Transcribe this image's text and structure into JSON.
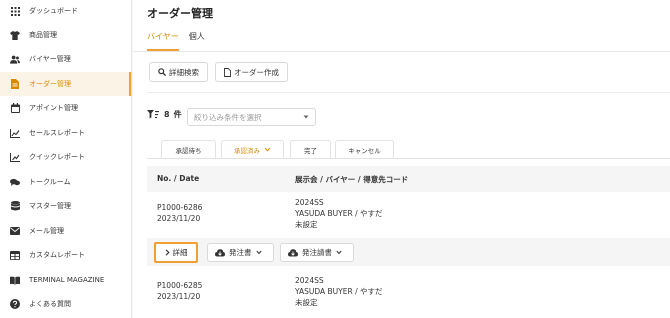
{
  "sidebar": {
    "items": [
      {
        "label": "ダッシュボード",
        "icon": "grid-icon"
      },
      {
        "label": "商品管理",
        "icon": "shirt-icon"
      },
      {
        "label": "バイヤー管理",
        "icon": "users-icon"
      },
      {
        "label": "オーダー管理",
        "icon": "document-icon",
        "active": true
      },
      {
        "label": "アポイント管理",
        "icon": "calendar-icon"
      },
      {
        "label": "セールスレポート",
        "icon": "trend-chart-icon"
      },
      {
        "label": "クイックレポート",
        "icon": "bar-chart-icon"
      },
      {
        "label": "トークルーム",
        "icon": "chat-icon"
      },
      {
        "label": "マスター管理",
        "icon": "database-icon"
      },
      {
        "label": "メール管理",
        "icon": "mail-icon"
      },
      {
        "label": "カスタムレポート",
        "icon": "table-icon"
      },
      {
        "label": "TERMINAL MAGAZINE",
        "icon": "book-icon"
      },
      {
        "label": "よくある質問",
        "icon": "question-icon"
      }
    ]
  },
  "main": {
    "title": "オーダー管理",
    "tabs": [
      {
        "label": "バイヤー",
        "active": true
      },
      {
        "label": "個人",
        "active": false
      }
    ],
    "buttons": {
      "detail_search": "詳細検索",
      "create_order": "オーダー作成"
    },
    "count": {
      "value": "8",
      "unit": "件"
    },
    "filter": {
      "placeholder": "絞り込み条件を選択"
    },
    "status_tabs": [
      {
        "label": "承認待ち",
        "active": false
      },
      {
        "label": "承認済み",
        "active": true
      },
      {
        "label": "完了",
        "active": false
      },
      {
        "label": "キャンセル",
        "active": false
      }
    ],
    "table": {
      "headers": [
        "No. / Date",
        "展示会 / バイヤー / 得意先コード"
      ],
      "rows": [
        {
          "no": "P1000-6286",
          "date": "2023/11/20",
          "season": "2024SS",
          "buyer": "YASUDA BUYER / やすだ",
          "code": "未設定"
        },
        {
          "no": "P1000-6285",
          "date": "2023/11/20",
          "season": "2024SS",
          "buyer": "YASUDA BUYER / やすだ",
          "code": "未設定"
        }
      ]
    },
    "row_actions": {
      "detail": "詳細",
      "order_sheet": "発注書",
      "invoice": "発注請書"
    }
  },
  "colors": {
    "accent": "#f0a030",
    "accent_text": "#d98a00"
  }
}
